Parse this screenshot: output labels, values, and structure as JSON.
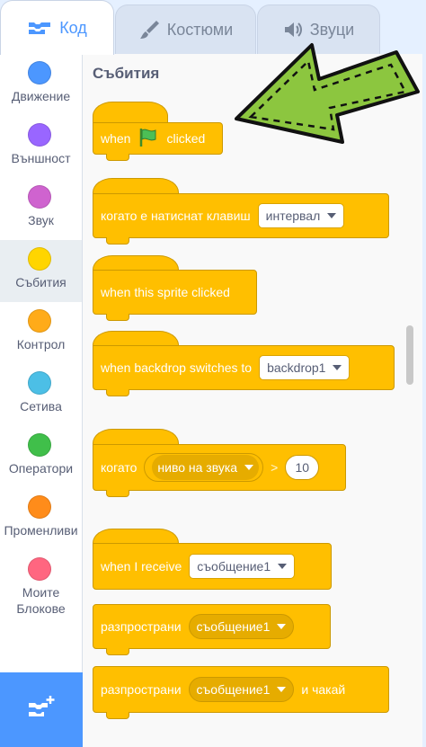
{
  "tabs": {
    "code": "Код",
    "costumes": "Костюми",
    "sounds": "Звуци"
  },
  "categories": [
    {
      "label": "Движение",
      "color": "#4c97ff",
      "icon": "motion-category-icon"
    },
    {
      "label": "Външност",
      "color": "#9966ff",
      "icon": "looks-category-icon"
    },
    {
      "label": "Звук",
      "color": "#cf63cf",
      "icon": "sound-category-icon"
    },
    {
      "label": "Събития",
      "color": "#ffd500",
      "icon": "events-category-icon"
    },
    {
      "label": "Контрол",
      "color": "#ffab19",
      "icon": "control-category-icon"
    },
    {
      "label": "Сетива",
      "color": "#4cbfe6",
      "icon": "sensing-category-icon"
    },
    {
      "label": "Оператори",
      "color": "#40bf4a",
      "icon": "operators-category-icon"
    },
    {
      "label": "Променливи",
      "color": "#ff8c1a",
      "icon": "variables-category-icon"
    },
    {
      "label": "Моите Блокове",
      "color": "#ff6680",
      "icon": "my-blocks-category-icon"
    }
  ],
  "section": {
    "title": "Събития"
  },
  "blocks": {
    "flag_clicked": {
      "when": "when",
      "clicked": "clicked"
    },
    "key_pressed": {
      "label": "когато е натиснат клавиш",
      "value": "интервал"
    },
    "sprite_clicked": {
      "label": "when this sprite clicked"
    },
    "backdrop_switches": {
      "label": "when backdrop switches to",
      "value": "backdrop1"
    },
    "greater_than": {
      "label": "когато",
      "value": "ниво на звука",
      "op": ">",
      "num": "10"
    },
    "receive": {
      "label": "when I receive",
      "value": "съобщение1"
    },
    "broadcast": {
      "label": "разпространи",
      "value": "съобщение1"
    },
    "broadcast_wait": {
      "label": "разпространи",
      "value": "съобщение1",
      "suffix": "и чакай"
    }
  },
  "colors": {
    "accent": "#4c97ff",
    "events": "#ffbf00",
    "arrow": "#8cc63f"
  }
}
